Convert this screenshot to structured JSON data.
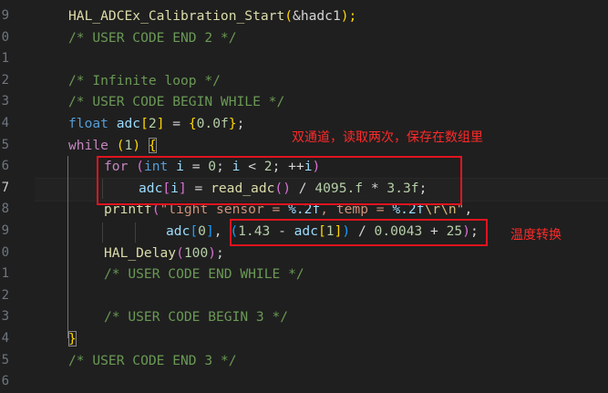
{
  "line_numbers": [
    "9",
    "0",
    "1",
    "2",
    "3",
    "4",
    "5",
    "6",
    "7",
    "8",
    "9",
    "0",
    "1",
    "2",
    "3",
    "4",
    "5",
    "6"
  ],
  "active_line_index": 8,
  "code": {
    "l0": {
      "fn": "HAL_ADCEx_Calibration_Start",
      "open": "(",
      "arg": "&hadc1",
      "close": ");"
    },
    "l1": {
      "comment": "/* USER CODE END 2 */"
    },
    "l3": {
      "comment": "/* Infinite loop */"
    },
    "l4": {
      "comment": "/* USER CODE BEGIN WHILE */"
    },
    "l5": {
      "type": "float",
      "var": "adc",
      "b1": "[",
      "size": "2",
      "b2": "]",
      "eq": " = ",
      "b3": "{",
      "val": "0.0f",
      "b4": "}",
      "semi": ";"
    },
    "l6": {
      "kw": "while",
      "sp": " ",
      "open": "(",
      "val": "1",
      "close": ")",
      "sp2": " ",
      "brace": "{"
    },
    "l7": {
      "kw": "for",
      "sp": " ",
      "open": "(",
      "type": "int",
      "v1": "i",
      "mid1": " = ",
      "n0": "0",
      "mid2": "; ",
      "v2": "i",
      "mid3": " < ",
      "n2": "2",
      "mid4": "; ++",
      "v3": "i",
      "close": ")"
    },
    "l8": {
      "var": "adc",
      "b1": "[",
      "idx": "i",
      "b2": "]",
      "eq": " = ",
      "fn": "read_adc",
      "call": "()",
      "div": " / ",
      "n1": "4095.f",
      "mul": " * ",
      "n2": "3.3f",
      "semi": ";"
    },
    "l9": {
      "fn": "printf",
      "open": "(",
      "s1": "\"light sensor = ",
      "f1": "%.2f",
      "s2": ", temp = ",
      "f2": "%.2f",
      "e1": "\\r\\n",
      "s3": "\"",
      "comma": ","
    },
    "l10": {
      "var": "adc",
      "b1": "[",
      "n0": "0",
      "b2": "]",
      "sep": ", ",
      "open": "(",
      "n1": "1.43",
      "minus": " - ",
      "var2": "adc",
      "b3": "[",
      "n2": "1",
      "b4": "]",
      "close": ")",
      "div": " / ",
      "n3": "0.0043",
      "plus": " + ",
      "n4": "25",
      "fclose": ")",
      "semi": ";"
    },
    "l11": {
      "fn": "HAL_Delay",
      "open": "(",
      "n": "100",
      "close": ")",
      "semi": ";"
    },
    "l12": {
      "comment": "/* USER CODE END WHILE */"
    },
    "l14": {
      "comment": "/* USER CODE BEGIN 3 */"
    },
    "l15": {
      "brace": "}"
    },
    "l16": {
      "comment": "/* USER CODE END 3 */"
    }
  },
  "annotations": {
    "note1": "双通道，读取两次，保存在数组里",
    "note2": "温度转换",
    "color": "#e0141e"
  }
}
